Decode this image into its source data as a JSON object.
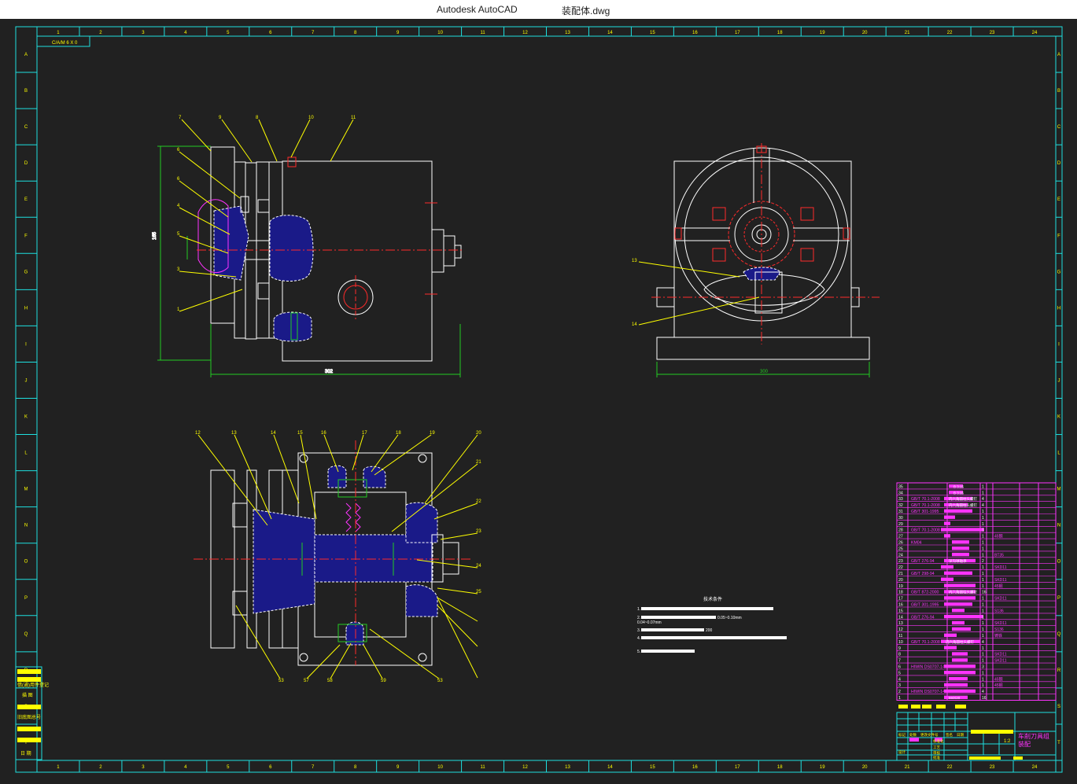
{
  "window": {
    "app_title": "Autodesk AutoCAD",
    "file_name": "装配体.dwg"
  },
  "drawing": {
    "border": {
      "columns": [
        "1",
        "2",
        "3",
        "4",
        "5",
        "6",
        "7",
        "8",
        "9",
        "10",
        "11",
        "12",
        "13",
        "14",
        "15",
        "16",
        "17",
        "18",
        "19",
        "20",
        "21",
        "22",
        "23",
        "24"
      ],
      "rows": [
        "A",
        "B",
        "C",
        "D",
        "E",
        "F",
        "G",
        "H",
        "I",
        "J",
        "K",
        "L",
        "M",
        "N",
        "O",
        "P",
        "Q",
        "R",
        "S",
        "T"
      ]
    },
    "corner_label": "C/A/M 6 X 0",
    "front_view_callouts": [
      "7",
      "9",
      "8",
      "10",
      "11",
      "6",
      "6",
      "4",
      "5",
      "3",
      "1",
      "2"
    ],
    "front_view_dims": [
      "165",
      "302"
    ],
    "side_view_callouts": [
      "13",
      "14"
    ],
    "side_view_dims": [
      "300"
    ],
    "section_view_top_callouts": [
      "12",
      "13",
      "14",
      "15",
      "16",
      "17",
      "18",
      "19",
      "20",
      "21",
      "22",
      "23",
      "24",
      "25"
    ],
    "section_view_bottom_callouts": [
      "53",
      "57",
      "58",
      "59",
      "53"
    ],
    "technical_requirements": {
      "title": "技术条件",
      "items": [
        {
          "num": "1.",
          "inline": ""
        },
        {
          "num": "2.",
          "inline": "0.05~0.10mm"
        },
        {
          "num": "",
          "inline": "0.04~0.07mm"
        },
        {
          "num": "3.",
          "inline": "200"
        },
        {
          "num": "4.",
          "inline": "0.0097mm"
        },
        {
          "num": "5.",
          "inline": ""
        }
      ]
    },
    "left_stamp_labels": [
      "借(通)用件登记",
      "描 图",
      "旧底图总号"
    ],
    "left_stamp_bottom": "日 期",
    "bom": {
      "rows": [
        {
          "no": "35",
          "code": "",
          "spec": "B 3:15",
          "qty": "1",
          "mat": ""
        },
        {
          "no": "34",
          "code": "",
          "spec": "B 3:15",
          "qty": "1",
          "mat": ""
        },
        {
          "no": "33",
          "code": "GB/T 70.1-2008",
          "spec": "内六角圆柱头螺钉",
          "qty": "4",
          "mat": ""
        },
        {
          "no": "32",
          "code": "GB/T 70.1-2008",
          "spec": "内六角圆柱头螺钉",
          "qty": "4",
          "mat": ""
        },
        {
          "no": "31",
          "code": "GB/T 301-1995",
          "spec": "",
          "qty": "1",
          "mat": ""
        },
        {
          "no": "30",
          "code": "",
          "spec": "",
          "qty": "1",
          "mat": ""
        },
        {
          "no": "29",
          "code": "",
          "spec": "",
          "qty": "1",
          "mat": ""
        },
        {
          "no": "28",
          "code": "GB/T 70.1-2008",
          "spec": "",
          "qty": "1",
          "mat": ""
        },
        {
          "no": "27",
          "code": "",
          "spec": "",
          "qty": "1",
          "mat": "45钢"
        },
        {
          "no": "26",
          "code": "KM04",
          "spec": "",
          "qty": "1",
          "mat": ""
        },
        {
          "no": "25",
          "code": "",
          "spec": "",
          "qty": "1",
          "mat": ""
        },
        {
          "no": "24",
          "code": "",
          "spec": "",
          "qty": "1",
          "mat": "BT35"
        },
        {
          "no": "23",
          "code": "GB/T 276-94",
          "spec": "深沟球轴承",
          "qty": "2",
          "mat": ""
        },
        {
          "no": "22",
          "code": "",
          "spec": "",
          "qty": "1",
          "mat": "SKD11"
        },
        {
          "no": "21",
          "code": "GB/T 298-94",
          "spec": "",
          "qty": "1",
          "mat": ""
        },
        {
          "no": "20",
          "code": "",
          "spec": "",
          "qty": "1",
          "mat": "SKD11"
        },
        {
          "no": "19",
          "code": "",
          "spec": "",
          "qty": "1",
          "mat": "45钢"
        },
        {
          "no": "18",
          "code": "GB/T 872-2000",
          "spec": "内六角圆柱头螺钉",
          "qty": "16",
          "mat": ""
        },
        {
          "no": "17",
          "code": "",
          "spec": "",
          "qty": "1",
          "mat": "SKD11"
        },
        {
          "no": "16",
          "code": "GB/T 301-1995",
          "spec": "",
          "qty": "1",
          "mat": ""
        },
        {
          "no": "15",
          "code": "",
          "spec": "",
          "qty": "1",
          "mat": "S136"
        },
        {
          "no": "14",
          "code": "GB/T 276-94",
          "spec": "",
          "qty": "1",
          "mat": ""
        },
        {
          "no": "13",
          "code": "",
          "spec": "",
          "qty": "1",
          "mat": "SKD11"
        },
        {
          "no": "12",
          "code": "",
          "spec": "",
          "qty": "1",
          "mat": "S136"
        },
        {
          "no": "11",
          "code": "",
          "spec": "",
          "qty": "1",
          "mat": "铸铁"
        },
        {
          "no": "10",
          "code": "GB/T 70.1-2008",
          "spec": "内六角圆柱头螺钉",
          "qty": "4",
          "mat": ""
        },
        {
          "no": "9",
          "code": "",
          "spec": "",
          "qty": "1",
          "mat": ""
        },
        {
          "no": "8",
          "code": "",
          "spec": "",
          "qty": "1",
          "mat": "SKD11"
        },
        {
          "no": "7",
          "code": "",
          "spec": "",
          "qty": "1",
          "mat": "SKD11"
        },
        {
          "no": "6",
          "code": "HIWIN DS0707-14",
          "spec": "",
          "qty": "3",
          "mat": ""
        },
        {
          "no": "5",
          "code": "",
          "spec": "",
          "qty": "1",
          "mat": ""
        },
        {
          "no": "4",
          "code": "",
          "spec": "",
          "qty": "1",
          "mat": "45钢"
        },
        {
          "no": "3",
          "code": "",
          "spec": "",
          "qty": "1",
          "mat": "45钢"
        },
        {
          "no": "2",
          "code": "HIWIN DS0707-14",
          "spec": "",
          "qty": "4",
          "mat": ""
        },
        {
          "no": "1",
          "code": "",
          "spec": "M4X20",
          "qty": "16",
          "mat": ""
        }
      ]
    },
    "title_block": {
      "scale": "1:2",
      "drawing_name": "车削刀具组",
      "drawing_name_2": "装配",
      "row_labels": [
        "标记",
        "处数",
        "更改文件号",
        "签名",
        "日期"
      ],
      "role_labels": [
        "设计",
        "标准化",
        "工艺",
        "审核",
        "批准"
      ]
    },
    "colors": {
      "background": "#212121",
      "frame": "#1ee0e0",
      "lines": "#ffffff",
      "leaders": "#ffff00",
      "hatch": "#1a1a88",
      "center": "#ff2a2a",
      "bom": "#ff33ff",
      "dimension": "#22cc22"
    }
  }
}
